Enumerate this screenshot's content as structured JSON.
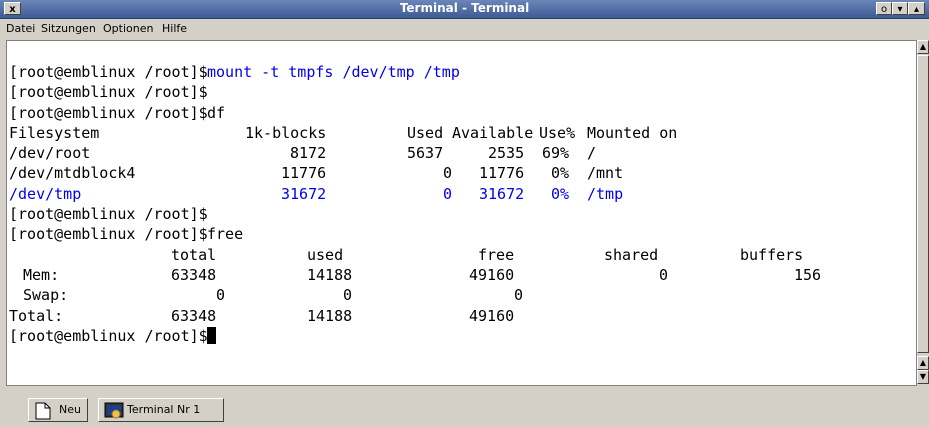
{
  "window": {
    "title": "Terminal - Terminal",
    "close_glyph": "x",
    "min_glyph": "o",
    "menu_glyph": "▾",
    "max_glyph": "▴"
  },
  "menu": {
    "items": [
      "Datei",
      "Sitzungen",
      "Optionen",
      "Hilfe"
    ]
  },
  "terminal": {
    "prompt": "[root@emblinux /root]$",
    "cmd_mount": "mount -t tmpfs /dev/tmp /tmp",
    "cmd_df": "df",
    "cmd_free": "free",
    "df": {
      "headers": [
        "Filesystem",
        "1k-blocks",
        "Used",
        "Available",
        "Use%",
        "Mounted on"
      ],
      "rows": [
        [
          "/dev/root",
          "8172",
          "5637",
          "2535",
          "69%",
          "/"
        ],
        [
          "/dev/mtdblock4",
          "11776",
          "0",
          "11776",
          "0%",
          "/mnt"
        ],
        [
          "/dev/tmp",
          "31672",
          "0",
          "31672",
          "0%",
          "/tmp"
        ]
      ]
    },
    "free": {
      "headers": [
        "total",
        "used",
        "free",
        "shared",
        "buffers"
      ],
      "rows": [
        [
          "Mem:",
          "63348",
          "14188",
          "49160",
          "0",
          "156"
        ],
        [
          "Swap:",
          "0",
          "0",
          "0"
        ],
        [
          "Total:",
          "63348",
          "14188",
          "49160"
        ]
      ]
    },
    "colors": {
      "command": "#0000ee",
      "highlight_row": "#0000ee"
    }
  },
  "tabs": {
    "new_label": "Neu",
    "session_label": "Terminal Nr 1"
  }
}
